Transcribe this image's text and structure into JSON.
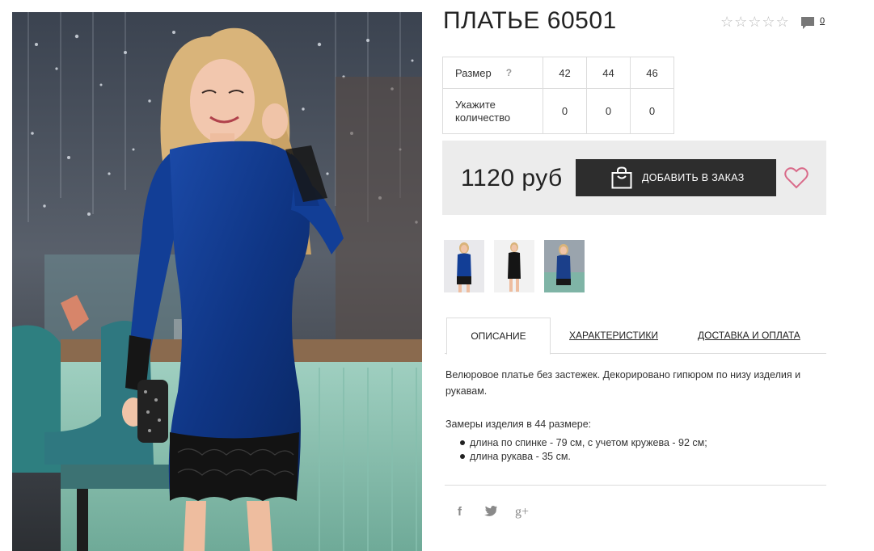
{
  "product": {
    "title": "ПЛАТЬЕ 60501",
    "rating_stars": 5,
    "rating_value": 0,
    "comment_count": "0"
  },
  "sizes": {
    "size_label": "Размер",
    "help": "?",
    "qty_label": "Укажите количество",
    "columns": [
      {
        "size": "42",
        "qty": "0"
      },
      {
        "size": "44",
        "qty": "0"
      },
      {
        "size": "46",
        "qty": "0"
      }
    ]
  },
  "order": {
    "price": "1120 руб",
    "add_button": "ДОБАВИТЬ В ЗАКАЗ"
  },
  "tabs": [
    {
      "label": "ОПИСАНИЕ",
      "active": true
    },
    {
      "label": "ХАРАКТЕРИСТИКИ",
      "active": false
    },
    {
      "label": "ДОСТАВКА И ОПЛАТА",
      "active": false
    }
  ],
  "description": {
    "text": "Велюровое платье без застежек. Декорировано гипюром по низу изделия и рукавам.",
    "measure_title": "Замеры изделия в 44 размере:",
    "measures": [
      "длина по спинке - 79 см, с учетом кружева - 92 см;",
      "длина рукава - 35 см."
    ]
  },
  "social": {
    "facebook": "f",
    "twitter": "twitter-icon",
    "gplus": "g+"
  },
  "colors": {
    "dress_blue": "#123c8c",
    "button_dark": "#2d2d2d",
    "heart_pink": "#d96b8a",
    "panel_gray": "#ececec"
  }
}
